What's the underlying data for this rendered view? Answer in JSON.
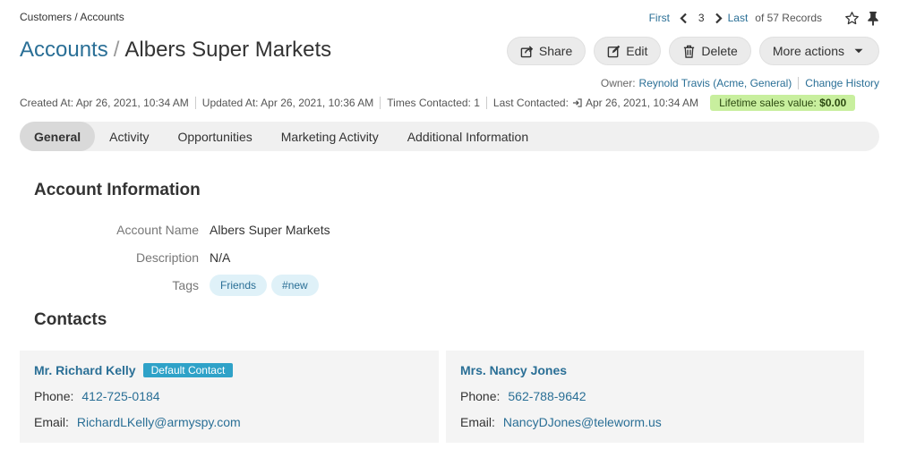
{
  "breadcrumb": "Customers / Accounts",
  "pager": {
    "first": "First",
    "current": "3",
    "last": "Last",
    "records": "of 57 Records"
  },
  "title": {
    "module": "Accounts",
    "separator": "/",
    "record": "Albers Super Markets"
  },
  "actions": {
    "share": "Share",
    "edit": "Edit",
    "delete": "Delete",
    "more": "More actions"
  },
  "owner": {
    "label": "Owner:",
    "value": "Reynold Travis (Acme, General)",
    "history": "Change History"
  },
  "meta": {
    "created": "Created At: Apr 26, 2021, 10:34 AM",
    "updated": "Updated At: Apr 26, 2021, 10:36 AM",
    "times": "Times Contacted: 1",
    "last_label": "Last Contacted:",
    "last_value": "Apr 26, 2021, 10:34 AM",
    "lifetime_label": "Lifetime sales value:",
    "lifetime_value": "$0.00"
  },
  "tabs": [
    "General",
    "Activity",
    "Opportunities",
    "Marketing Activity",
    "Additional Information"
  ],
  "account_info": {
    "heading": "Account Information",
    "name_label": "Account Name",
    "name_value": "Albers Super Markets",
    "desc_label": "Description",
    "desc_value": "N/A",
    "tags_label": "Tags",
    "tags": [
      "Friends",
      "#new"
    ]
  },
  "contacts": {
    "heading": "Contacts",
    "items": [
      {
        "name": "Mr. Richard Kelly",
        "badge": "Default Contact",
        "phone_label": "Phone:",
        "phone": "412-725-0184",
        "email_label": "Email:",
        "email": "RichardLKelly@armyspy.com"
      },
      {
        "name": "Mrs. Nancy Jones",
        "badge": "",
        "phone_label": "Phone:",
        "phone": "562-788-9642",
        "email_label": "Email:",
        "email": "NancyDJones@teleworm.us"
      }
    ]
  },
  "colors": {
    "link": "#2a6f96",
    "badge_green": "#c8ef9e",
    "default_badge": "#2fa2c8",
    "tag_bg": "#dff1f8"
  },
  "icons": {
    "prev": "chevron-left-icon",
    "next": "chevron-right-icon",
    "favorite": "star-icon",
    "pin": "pin-icon",
    "share": "share-icon",
    "edit": "edit-icon",
    "delete": "trash-icon",
    "more": "caret-down-icon",
    "last_contacted": "sign-in-icon"
  }
}
